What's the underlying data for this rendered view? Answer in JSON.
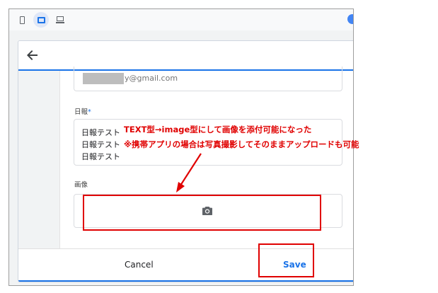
{
  "form": {
    "email_value": "y@gmail.com",
    "nippo_label": "日報",
    "required_mark": "*",
    "nippo_lines": [
      "日報テスト",
      "日報テスト",
      "日報テスト"
    ],
    "image_label": "画像"
  },
  "footer": {
    "cancel_label": "Cancel",
    "save_label": "Save"
  },
  "annotation": {
    "line1": "TEXT型→image型にして画像を添付可能になった",
    "line2": "※携帯アプリの場合は写真撮影してそのままアップロードも可能"
  },
  "icons": [
    "phone-icon",
    "tablet-icon",
    "laptop-icon",
    "back-arrow-icon",
    "camera-icon"
  ],
  "colors": {
    "accent": "#1a73e8",
    "annotation_red": "#e00000"
  }
}
